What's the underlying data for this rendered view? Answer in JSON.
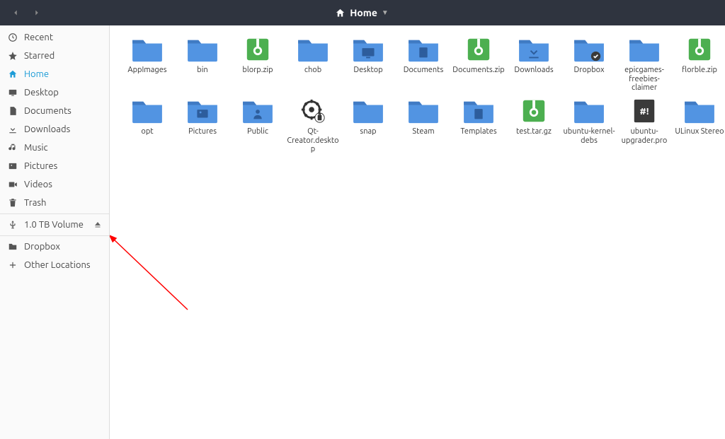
{
  "header": {
    "title": "Home"
  },
  "sidebar": {
    "items": [
      {
        "label": "Recent",
        "icon": "recent"
      },
      {
        "label": "Starred",
        "icon": "star"
      },
      {
        "label": "Home",
        "icon": "home",
        "active": true
      },
      {
        "label": "Desktop",
        "icon": "desktop"
      },
      {
        "label": "Documents",
        "icon": "documents"
      },
      {
        "label": "Downloads",
        "icon": "downloads"
      },
      {
        "label": "Music",
        "icon": "music"
      },
      {
        "label": "Pictures",
        "icon": "pictures"
      },
      {
        "label": "Videos",
        "icon": "videos"
      },
      {
        "label": "Trash",
        "icon": "trash"
      }
    ],
    "devices": [
      {
        "label": "1.0 TB Volume",
        "icon": "usb",
        "ejectable": true
      }
    ],
    "network": [
      {
        "label": "Dropbox",
        "icon": "folder"
      },
      {
        "label": "Other Locations",
        "icon": "plus"
      }
    ]
  },
  "files": [
    {
      "name": "AppImages",
      "type": "folder"
    },
    {
      "name": "bin",
      "type": "folder"
    },
    {
      "name": "blorp.zip",
      "type": "zip"
    },
    {
      "name": "chob",
      "type": "folder"
    },
    {
      "name": "Desktop",
      "type": "folder-desktop"
    },
    {
      "name": "Documents",
      "type": "folder-documents"
    },
    {
      "name": "Documents.zip",
      "type": "zip"
    },
    {
      "name": "Downloads",
      "type": "folder-downloads"
    },
    {
      "name": "Dropbox",
      "type": "folder-dropbox"
    },
    {
      "name": "epicgames-freebies-claimer",
      "type": "folder"
    },
    {
      "name": "florble.zip",
      "type": "zip"
    },
    {
      "name": "opt",
      "type": "folder"
    },
    {
      "name": "Pictures",
      "type": "folder-pictures"
    },
    {
      "name": "Public",
      "type": "folder-public"
    },
    {
      "name": "Qt-Creator.desktop",
      "type": "desktop-file"
    },
    {
      "name": "snap",
      "type": "folder"
    },
    {
      "name": "Steam",
      "type": "folder"
    },
    {
      "name": "Templates",
      "type": "folder-templates"
    },
    {
      "name": "test.tar.gz",
      "type": "tarball"
    },
    {
      "name": "ubuntu-kernel-debs",
      "type": "folder"
    },
    {
      "name": "ubuntu-upgrader.pro",
      "type": "pro"
    },
    {
      "name": "ULinux Stereo",
      "type": "folder"
    }
  ],
  "colors": {
    "folder": "#5294e2",
    "archive_green": "#4caf50",
    "header_bg": "#2f343f",
    "accent": "#1e9cd7"
  }
}
